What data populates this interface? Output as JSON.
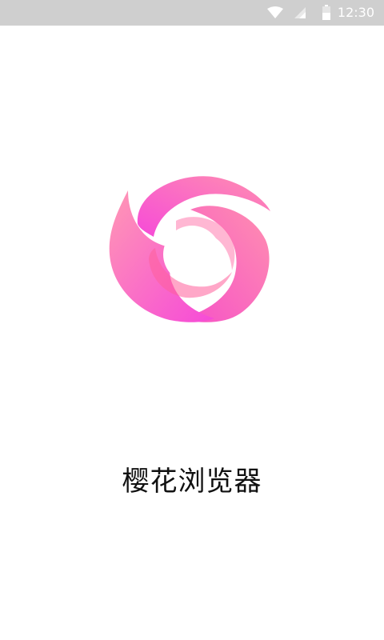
{
  "status_bar": {
    "time": "12:30",
    "icons": [
      "wifi-icon",
      "signal-icon",
      "battery-icon"
    ],
    "background": "#cfcfcf"
  },
  "splash": {
    "app_name": "樱花浏览器",
    "logo_icon": "sakura-swirl-logo-icon",
    "colors": {
      "pink_light": "#ff8fb0",
      "pink_mid": "#ff5fa0",
      "magenta": "#f64ad8"
    }
  }
}
